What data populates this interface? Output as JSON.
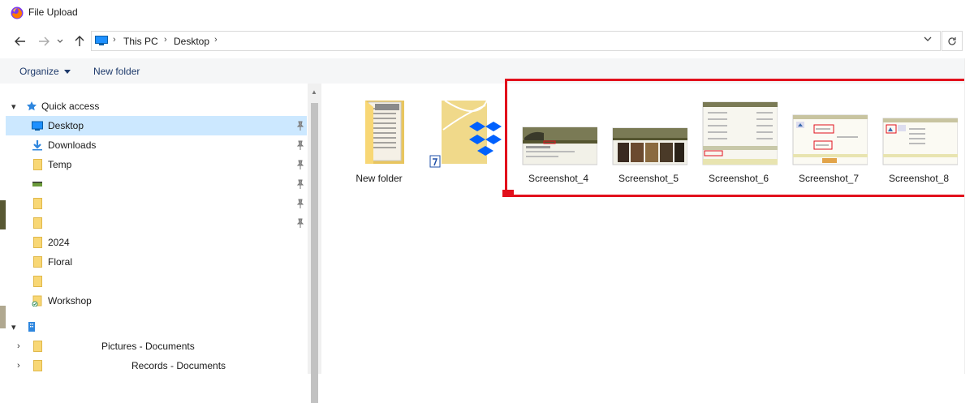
{
  "window": {
    "title": "File Upload"
  },
  "address": {
    "crumbs": [
      "This PC",
      "Desktop"
    ]
  },
  "toolbar": {
    "organize_label": "Organize",
    "new_folder_label": "New folder"
  },
  "nav": {
    "items": [
      {
        "label": "Quick access",
        "chevron": "▾",
        "icon": "star-icon"
      },
      {
        "label": "Desktop",
        "selected": true,
        "pinned": true,
        "icon": "desktop-icon"
      },
      {
        "label": "Downloads",
        "pinned": true,
        "icon": "download-icon"
      },
      {
        "label": "Temp",
        "pinned": true,
        "icon": "folder-icon"
      },
      {
        "label": "",
        "pinned": true,
        "icon": "drive-icon"
      },
      {
        "label": "",
        "pinned": true,
        "icon": "folder-icon"
      },
      {
        "label": "",
        "pinned": true,
        "icon": "folder-icon"
      },
      {
        "label": "2024",
        "icon": "folder-icon"
      },
      {
        "label": "Floral",
        "icon": "folder-icon"
      },
      {
        "label": "",
        "icon": "folder-icon"
      },
      {
        "label": "Workshop",
        "icon": "sync-folder-icon"
      },
      {
        "label": "",
        "chevron": "▾",
        "icon": "building-icon"
      },
      {
        "label": "Pictures - Documents",
        "chevron": "›",
        "icon": "folder-icon"
      },
      {
        "label": "Records - Documents",
        "chevron": "›",
        "icon": "folder-icon"
      }
    ]
  },
  "content": {
    "items": [
      {
        "label": "New folder",
        "type": "folder"
      },
      {
        "label": "",
        "type": "dropbox-folder"
      },
      {
        "label": "Screenshot_4",
        "type": "image"
      },
      {
        "label": "Screenshot_5",
        "type": "image"
      },
      {
        "label": "Screenshot_6",
        "type": "image"
      },
      {
        "label": "Screenshot_7",
        "type": "image"
      },
      {
        "label": "Screenshot_8",
        "type": "image"
      }
    ]
  },
  "colors": {
    "accent": "#0078d7",
    "selection": "#cce8ff",
    "highlight": "#e2101c",
    "folder": "#f8d775"
  }
}
